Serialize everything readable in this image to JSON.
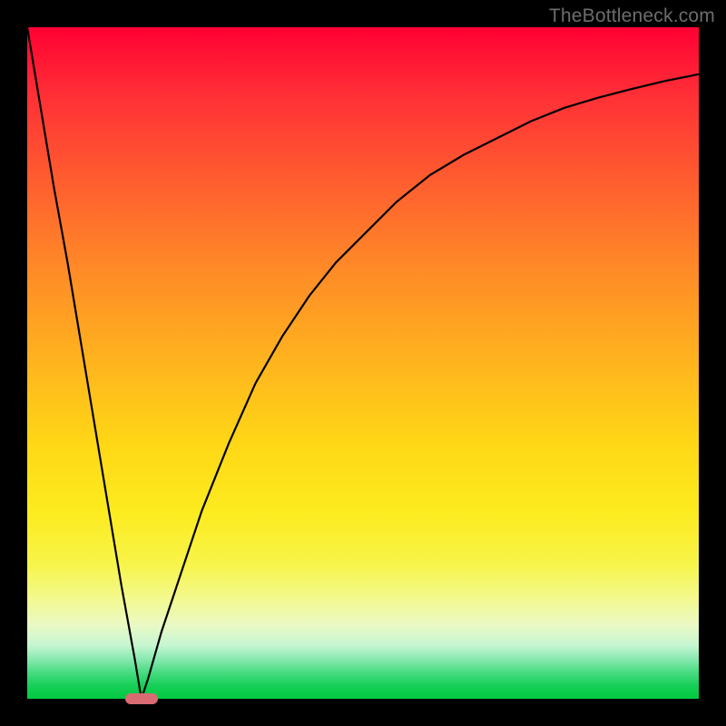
{
  "watermark": "TheBottleneck.com",
  "chart_data": {
    "type": "line",
    "title": "",
    "xlabel": "",
    "ylabel": "",
    "xlim": [
      0,
      100
    ],
    "ylim": [
      0,
      100
    ],
    "grid": false,
    "legend": false,
    "background_gradient": {
      "direction": "vertical",
      "stops": [
        {
          "pos": 0,
          "color": "#ff0033"
        },
        {
          "pos": 50,
          "color": "#ffb41e"
        },
        {
          "pos": 80,
          "color": "#f7f44a"
        },
        {
          "pos": 100,
          "color": "#00c940"
        }
      ]
    },
    "series": [
      {
        "name": "bottleneck-curve",
        "color": "#000000",
        "x": [
          0,
          2,
          4,
          6,
          8,
          10,
          12,
          14,
          16,
          17,
          18,
          20,
          22,
          24,
          26,
          28,
          30,
          34,
          38,
          42,
          46,
          50,
          55,
          60,
          65,
          70,
          75,
          80,
          85,
          90,
          95,
          100
        ],
        "y": [
          100,
          88,
          76,
          65,
          53,
          41,
          29,
          17,
          6,
          0,
          3,
          10,
          16,
          22,
          28,
          33,
          38,
          47,
          54,
          60,
          65,
          69,
          74,
          78,
          81,
          83.5,
          86,
          88,
          89.5,
          90.8,
          92,
          93
        ]
      }
    ],
    "marker": {
      "name": "optimal-point",
      "x": 17,
      "y": 0,
      "color": "#d96b72",
      "shape": "pill"
    }
  }
}
